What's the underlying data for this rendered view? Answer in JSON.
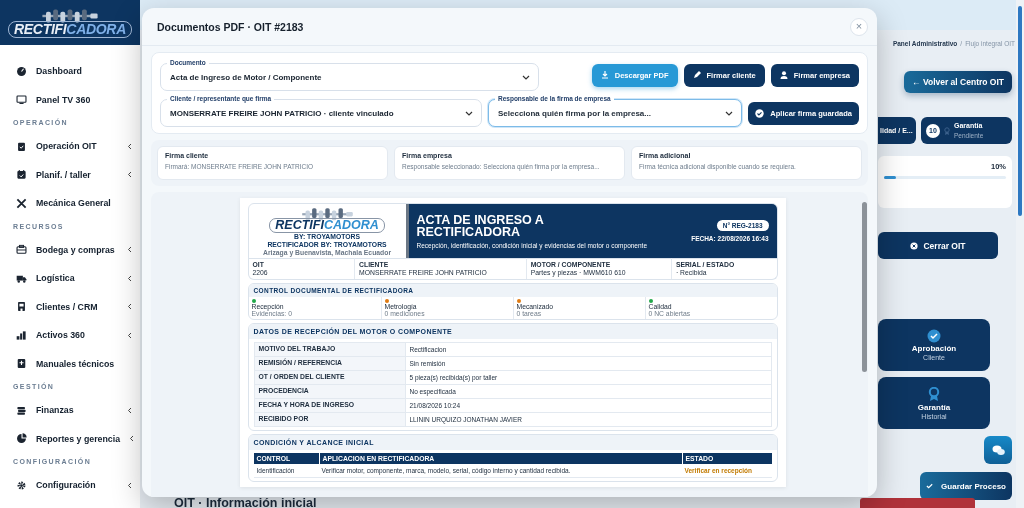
{
  "sidebar": {
    "logo": {
      "part_1": "RECTIFI",
      "part_2": "CADORA"
    },
    "sections": [
      {
        "items": [
          {
            "label": "Dashboard",
            "expandable": false
          },
          {
            "label": "Panel TV 360",
            "expandable": false
          }
        ]
      },
      {
        "title": "OPERACIÓN",
        "items": [
          {
            "label": "Operación OIT",
            "expandable": true
          },
          {
            "label": "Planif. / taller",
            "expandable": true
          },
          {
            "label": "Mecánica General",
            "expandable": false
          }
        ]
      },
      {
        "title": "RECURSOS",
        "items": [
          {
            "label": "Bodega y compras",
            "expandable": true
          },
          {
            "label": "Logística",
            "expandable": true
          },
          {
            "label": "Clientes / CRM",
            "expandable": true
          },
          {
            "label": "Activos 360",
            "expandable": true
          },
          {
            "label": "Manuales técnicos",
            "expandable": false
          }
        ]
      },
      {
        "title": "GESTIÓN",
        "items": [
          {
            "label": "Finanzas",
            "expandable": true
          },
          {
            "label": "Reportes y gerencia",
            "expandable": true
          }
        ]
      },
      {
        "title": "CONFIGURACIÓN",
        "items": [
          {
            "label": "Configuración",
            "expandable": true
          }
        ]
      }
    ]
  },
  "background": {
    "breadcrumb": [
      "Panel Administrativo",
      "Flujo integral OIT"
    ],
    "breadcrumb_separator": "/",
    "back_button": "← Volver al Centro OIT",
    "steps": [
      {
        "title": "lidad / E..."
      },
      {
        "number": "10",
        "title": "Garantía",
        "status": "Pendiente"
      }
    ],
    "progress": {
      "reading": "10%",
      "level": 0.1
    },
    "close_button": "Cerrar OIT",
    "phase_cards": [
      {
        "title": "Aprobación",
        "subtitle": "Cliente"
      },
      {
        "title": "Garantía",
        "subtitle": "Historial"
      }
    ],
    "save_button": "Guardar Proceso",
    "section_title": "OIT · Información inicial"
  },
  "modal": {
    "title": "Documentos PDF · OIT #2183",
    "close": "×",
    "document_field": {
      "label": "Documento",
      "value": "Acta de Ingreso de Motor / Componente"
    },
    "buttons": [
      {
        "label": "Descargar PDF",
        "kind": "primary"
      },
      {
        "label": "Firmar cliente",
        "kind": "dark"
      },
      {
        "label": "Firmar empresa",
        "kind": "dark"
      }
    ],
    "client_field": {
      "label": "Cliente / representante que firma",
      "value": "MONSERRATE FREIRE JOHN PATRICIO · cliente vinculado",
      "focused": false
    },
    "company_field": {
      "label": "Responsable de la firma de empresa",
      "placeholder": "Selecciona quién firma por la empresa...",
      "focused": true
    },
    "apply_button": "Aplicar firma guardada",
    "signatures": [
      {
        "title": "Firma cliente",
        "text": "Firmará: MONSERRATE FREIRE JOHN PATRICIO"
      },
      {
        "title": "Firma empresa",
        "text": "Responsable seleccionado: Selecciona quién firma por la empresa..."
      },
      {
        "title": "Firma adicional",
        "text": "Firma técnica adicional disponible cuando se requiera."
      }
    ],
    "document": {
      "logo": {
        "part_1": "RECTIFI",
        "part_2": "CADORA"
      },
      "brand_lines": [
        "BY: TROYAMOTORS",
        "RECTIFICADOR BY: TROYAMOTORS"
      ],
      "address": "Arizaga y Buenavista, Machala Ecuador",
      "title": "ACTA DE INGRESO A RECTIFICADORA",
      "subtitle": "Recepción, identificación, condición inicial y evidencias del motor o componente",
      "number": "N° REG-2183",
      "date": "FECHA: 22/08/2026 16:43",
      "info": [
        {
          "label": "OIT",
          "value": "2206"
        },
        {
          "label": "CLIENTE",
          "value": "MONSERRATE FREIRE JOHN PATRICIO"
        },
        {
          "label": "MOTOR / COMPONENTE",
          "value": "Partes y piezas · MWM610 610"
        },
        {
          "label": "SERIAL / ESTADO",
          "value": "· Recibida"
        }
      ],
      "control_title": "CONTROL DOCUMENTAL DE RECTIFICADORA",
      "controls": [
        {
          "name": "Recepción",
          "detail": "Evidencias: 0",
          "color": "#22a84a"
        },
        {
          "name": "Metrología",
          "detail": "0 mediciones",
          "color": "#e07b12"
        },
        {
          "name": "Mecanizado",
          "detail": "0 tareas",
          "color": "#e07b12"
        },
        {
          "name": "Calidad",
          "detail": "0 NC abiertas",
          "color": "#22a84a"
        }
      ],
      "reception_title": "DATOS DE RECEPCIÓN DEL MOTOR O COMPONENTE",
      "reception_rows": [
        {
          "label": "MOTIVO DEL TRABAJO",
          "value": "Rectificacion"
        },
        {
          "label": "REMISIÓN / REFERENCIA",
          "value": "Sin remisión"
        },
        {
          "label": "OT / ORDEN DEL CLIENTE",
          "value": "5 pieza(s) recibida(s) por taller"
        },
        {
          "label": "PROCEDENCIA",
          "value": "No especificada"
        },
        {
          "label": "FECHA Y HORA DE INGRESO",
          "value": "21/08/2026 10:24"
        },
        {
          "label": "RECIBIDO POR",
          "value": "LLININ URQUIZO JONATHAN JAVIER"
        }
      ],
      "condition_title": "CONDICIÓN Y ALCANCE INICIAL",
      "condition_columns": [
        "CONTROL",
        "APLICACION EN RECTIFICADORA",
        "ESTADO"
      ],
      "condition_rows": [
        {
          "control": "Identificación",
          "application": "Verificar motor, componente, marca, modelo, serial, código interno y cantidad recibida.",
          "status": "Verificar en recepción"
        }
      ]
    }
  }
}
